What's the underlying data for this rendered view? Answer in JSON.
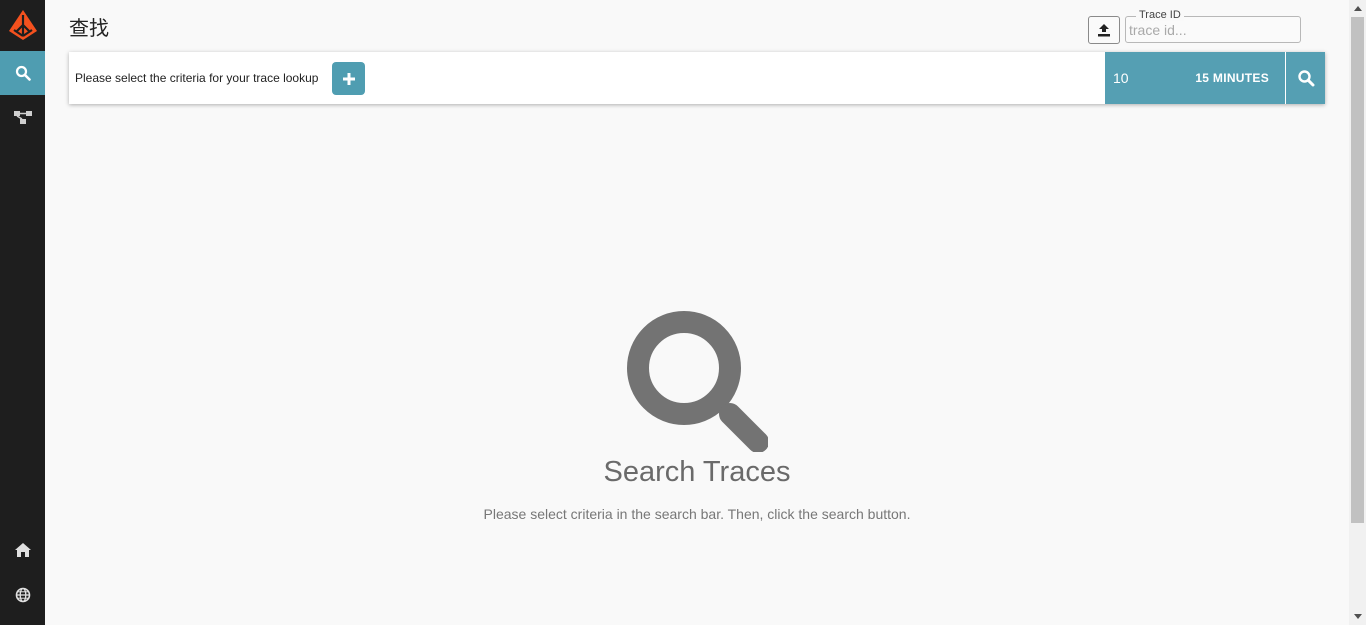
{
  "sidebar": {
    "logo_icon": "zipkin-logo",
    "items": [
      {
        "icon": "search-icon",
        "active": true
      },
      {
        "icon": "dependencies-icon",
        "active": false
      },
      {
        "icon": "home-icon",
        "active": false
      },
      {
        "icon": "globe-icon",
        "active": false
      }
    ]
  },
  "header": {
    "title": "查找"
  },
  "trace_lookup": {
    "label": "Trace ID",
    "placeholder": "trace id...",
    "upload_icon": "upload-icon"
  },
  "search_bar": {
    "criteria_prompt": "Please select the criteria for your trace lookup",
    "add_icon": "plus-icon",
    "limit": "10",
    "lookback": "15 MINUTES",
    "search_icon": "search-icon"
  },
  "empty_state": {
    "icon": "search-icon",
    "title": "Search Traces",
    "description": "Please select criteria in the search bar. Then, click the search button."
  },
  "colors": {
    "accent": "#4f9db1",
    "sidebar_bg": "#1e1e1e",
    "logo_orange": "#f4511e"
  }
}
